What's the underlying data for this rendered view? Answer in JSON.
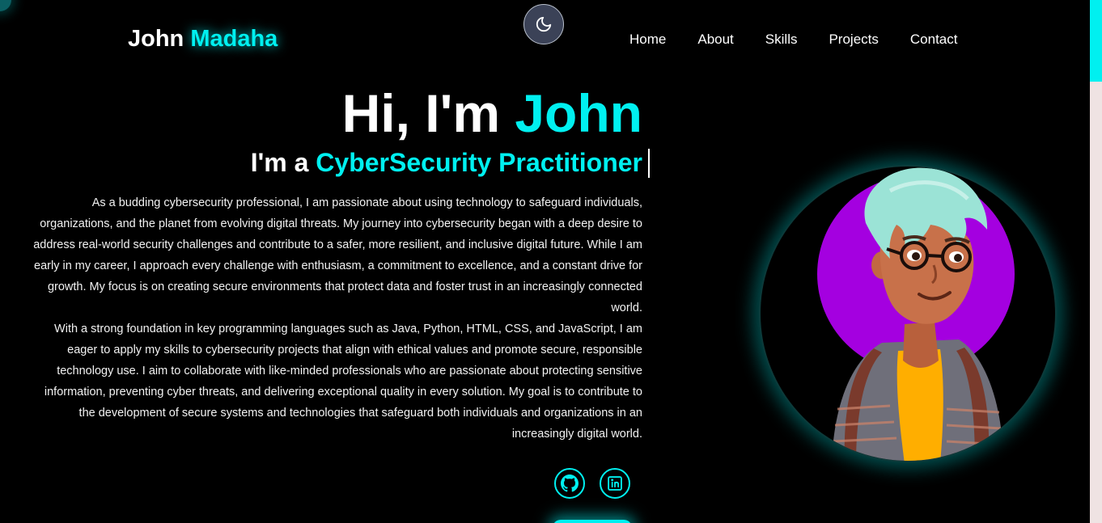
{
  "logo": {
    "first": "John",
    "last": "Madaha"
  },
  "theme_toggle": {
    "icon": "moon-icon"
  },
  "nav": {
    "items": [
      "Home",
      "About",
      "Skills",
      "Projects",
      "Contact"
    ]
  },
  "hero": {
    "greeting": "Hi, I'm",
    "name": "John",
    "role_prefix": "I'm a",
    "role": "CyberSecurity Practitioner"
  },
  "bio": {
    "paragraph1": "As a budding cybersecurity professional, I am passionate about using technology to safeguard individuals, organizations, and the planet from evolving digital threats. My journey into cybersecurity began with a deep desire to address real-world security challenges and contribute to a safer, more resilient, and inclusive digital future. While I am early in my career, I approach every challenge with enthusiasm, a commitment to excellence, and a constant drive for growth. My focus is on creating secure environments that protect data and foster trust in an increasingly connected world.",
    "paragraph2": "With a strong foundation in key programming languages such as Java, Python, HTML, CSS, and JavaScript, I am eager to apply my skills to cybersecurity projects that align with ethical values and promote secure, responsible technology use. I aim to collaborate with like-minded professionals who are passionate about protecting sensitive information, preventing cyber threats, and delivering exceptional quality in every solution. My goal is to contribute to the development of secure systems and technologies that safeguard both individuals and organizations in an increasingly digital world."
  },
  "socials": {
    "icons": [
      "github-icon",
      "linkedin-icon"
    ]
  },
  "colors": {
    "accent": "#00f0f0",
    "background": "#000000",
    "avatar_bg": "#a400e0"
  }
}
